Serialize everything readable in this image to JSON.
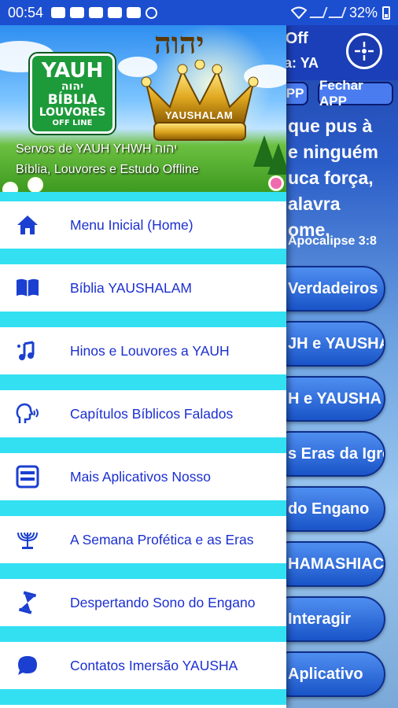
{
  "status_bar": {
    "time": "00:54",
    "battery": "32%",
    "icons": [
      "gmail-icon",
      "youtube-icon",
      "youtube-icon",
      "youtube-icon",
      "image-icon",
      "sync-icon"
    ]
  },
  "background_app": {
    "title_fragment": "es Off",
    "subtitle_fragment": "ncia: YA",
    "buttons": [
      "APP",
      "Fechar APP"
    ],
    "verse_lines": [
      "que pus à",
      "e ninguém",
      "uca força,",
      "alavra",
      "ome."
    ],
    "verse_ref": "Apocalipse 3:8",
    "pills": [
      "Verdadeiros",
      "JH e YAUSHA",
      "H e YAUSHA",
      "s Eras da Igreja",
      "do Engano",
      "HAMASHIACH",
      "Interagir",
      "Aplicativo"
    ]
  },
  "drawer": {
    "header": {
      "logo": {
        "line1": "YAUH",
        "line2": "יהוה",
        "line3": "BÍBLIA",
        "line4": "LOUVORES",
        "line5": "OFF LINE"
      },
      "hebrew_title": "יהוה",
      "crown_label": "YAUSHALAM",
      "line1": "Servos de YAUH YHWH יהוה",
      "line2": "Bíblia, Louvores e Estudo Offline"
    },
    "menu_items": [
      {
        "label": "Menu Inicial (Home)",
        "icon": "home-icon"
      },
      {
        "label": "Bíblia YAUSHALAM",
        "icon": "book-icon"
      },
      {
        "label": "Hinos e Louvores a YAUH",
        "icon": "music-icon"
      },
      {
        "label": "Capítulos Bíblicos Falados",
        "icon": "speaking-head-icon"
      },
      {
        "label": "Mais Aplicativos Nosso",
        "icon": "more-apps-icon"
      },
      {
        "label": "A Semana Profética e as Eras",
        "icon": "menorah-icon"
      },
      {
        "label": "Despertando Sono do Engano",
        "icon": "hourglass-icon"
      },
      {
        "label": "Contatos Imersão YAUSHA",
        "icon": "chat-icon"
      }
    ],
    "colors": {
      "separator": "#33e0f2",
      "label": "#1b2fd0",
      "icon": "#1b3fd0"
    }
  }
}
